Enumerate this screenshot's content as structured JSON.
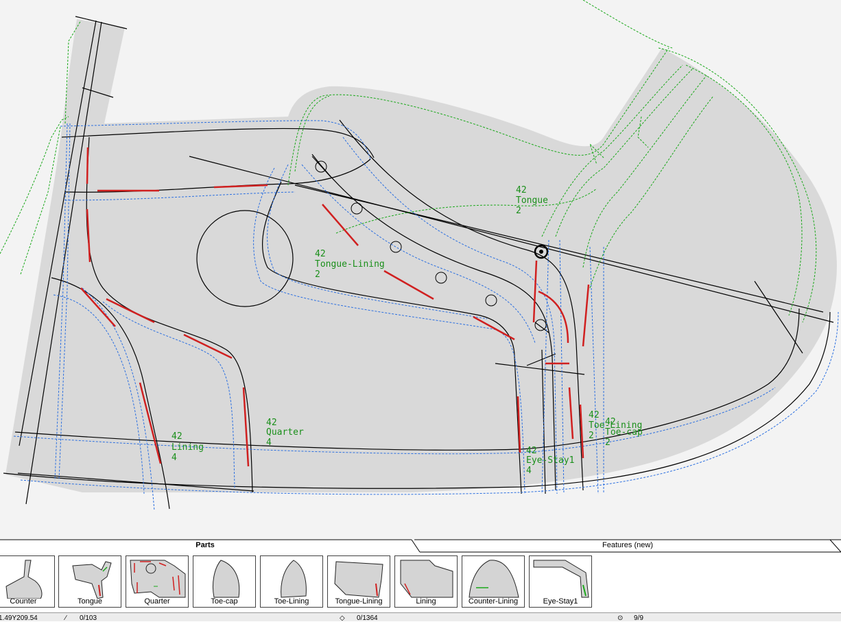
{
  "canvas": {
    "piece_labels": [
      {
        "size": "42",
        "name": "Tongue",
        "qty": "2"
      },
      {
        "size": "42",
        "name": "Tongue-Lining",
        "qty": "2"
      },
      {
        "size": "42",
        "name": "Lining",
        "qty": "4"
      },
      {
        "size": "42",
        "name": "Quarter",
        "qty": "4"
      },
      {
        "size": "42",
        "name": "Eye-Stay1",
        "qty": "4"
      },
      {
        "size": "42",
        "name": "Toe-Lining",
        "qty": "2"
      },
      {
        "size": "42",
        "name": "Toe-cap",
        "qty": "2"
      }
    ],
    "colors": {
      "background": "#f3f3f3",
      "piece_fill": "#d9d9d9",
      "outline": "#000000",
      "seam_allowance": "#2b6fe0",
      "pattern_guide": "#1aa81a",
      "marker": "#d02020"
    }
  },
  "tabs": {
    "parts_label": "Parts",
    "features_label": "Features (new)"
  },
  "parts": [
    {
      "label": "Counter",
      "icon": "counter-shape-icon"
    },
    {
      "label": "Tongue",
      "icon": "tongue-shape-icon"
    },
    {
      "label": "Quarter",
      "icon": "quarter-shape-icon"
    },
    {
      "label": "Toe-cap",
      "icon": "toe-cap-shape-icon"
    },
    {
      "label": "Toe-Lining",
      "icon": "toe-lining-shape-icon"
    },
    {
      "label": "Tongue-Lining",
      "icon": "tongue-lining-shape-icon"
    },
    {
      "label": "Lining",
      "icon": "lining-shape-icon"
    },
    {
      "label": "Counter-Lining",
      "icon": "counter-lining-shape-icon"
    },
    {
      "label": "Eye-Stay1",
      "icon": "eye-stay-shape-icon"
    }
  ],
  "status": {
    "coords": "1.49Y209.54",
    "segments": "0/103",
    "points": "0/1364",
    "pages": "9/9"
  }
}
